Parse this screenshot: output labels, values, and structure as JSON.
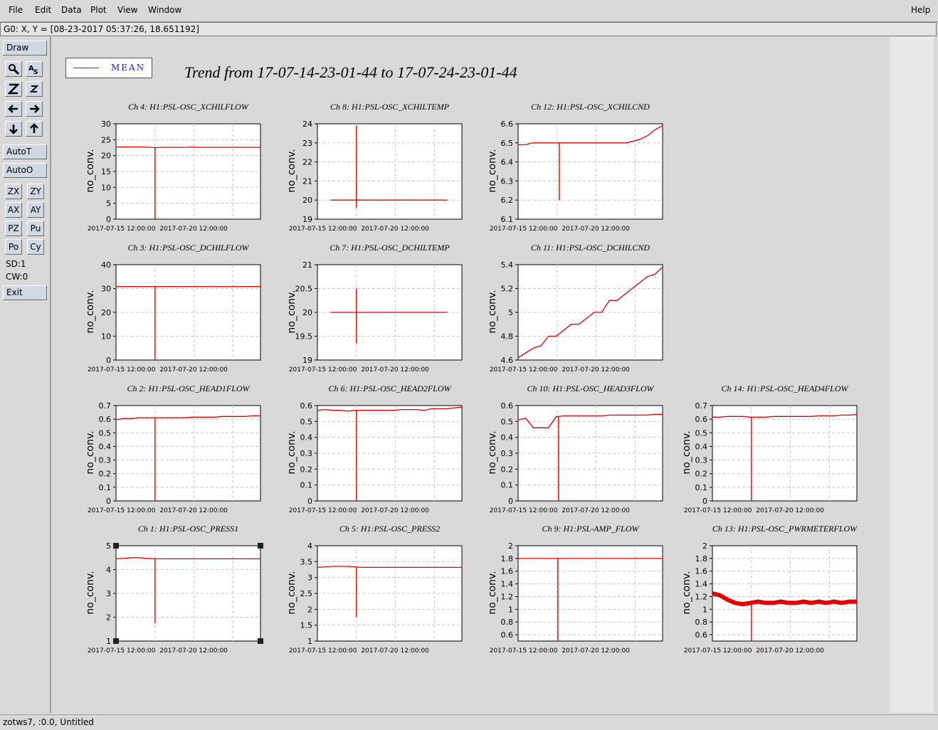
{
  "menubar": {
    "items": [
      {
        "label": "File"
      },
      {
        "label": "Edit"
      },
      {
        "label": "Data"
      },
      {
        "label": "Plot"
      },
      {
        "label": "View"
      },
      {
        "label": "Window"
      }
    ],
    "help": "Help"
  },
  "coord_readout": "G0: X, Y = [08-23-2017 05:37:26, 18.651192]",
  "toolbar": {
    "draw": "Draw",
    "autot": "AutoT",
    "autoo": "AutoO",
    "pairs": [
      [
        "ZX",
        "ZY"
      ],
      [
        "AX",
        "AY"
      ],
      [
        "PZ",
        "Pu"
      ],
      [
        "Po",
        "Cy"
      ]
    ],
    "sd": "SD:1",
    "cw": "CW:0",
    "exit": "Exit"
  },
  "legend": {
    "label": "MEAN",
    "color": "#e00000"
  },
  "title": "Trend from 17-07-14-23-01-44 to 17-07-24-23-01-44",
  "status": "zotws7, :0.0, Untitled",
  "chart_data": [
    {
      "type": "line",
      "title": "Ch 4: H1:PSL-OSC_XCHILFLOW",
      "ylabel": "no_conv.",
      "ylim": [
        0,
        30
      ],
      "yticks": [
        "0",
        "5",
        "10",
        "15",
        "20",
        "25",
        "30"
      ],
      "xticks": [
        "2017-07-15 12:00:00",
        "2017-07-20 12:00:00"
      ],
      "series": [
        {
          "values": [
            22.7,
            22.7,
            22.7,
            22.7,
            22.7,
            22.5,
            22.6,
            22.6,
            22.6,
            22.6,
            22.7,
            22.6,
            22.6,
            22.6,
            22.6,
            22.6,
            22.6,
            22.6,
            22.6,
            22.6
          ],
          "spike_down": 0
        }
      ]
    },
    {
      "type": "line",
      "title": "Ch 8: H1:PSL-OSC_XCHILTEMP",
      "ylabel": "no_conv.",
      "ylim": [
        19,
        24
      ],
      "yticks": [
        "19",
        "20",
        "21",
        "22",
        "23",
        "24"
      ],
      "xticks": [
        "2017-07-15 12:00:00",
        "2017-07-20 12:00:00"
      ],
      "series": [
        {
          "values": [
            20,
            20,
            20,
            20,
            20,
            20,
            20,
            20,
            20,
            20,
            20,
            20,
            20,
            20,
            20,
            20,
            20,
            20
          ],
          "spike_up": 23.9,
          "spike_down": 19.6
        }
      ]
    },
    {
      "type": "line",
      "title": "Ch 12: H1:PSL-OSC_XCHILCND",
      "ylabel": "no_conv.",
      "ylim": [
        6.1,
        6.6
      ],
      "yticks": [
        "6.1",
        "6.2",
        "6.3",
        "6.4",
        "6.5",
        "6.6"
      ],
      "xticks": [
        "2017-07-15 12:00:00",
        "2017-07-20 12:00:00"
      ],
      "series": [
        {
          "values": [
            6.49,
            6.49,
            6.5,
            6.5,
            6.5,
            6.5,
            6.5,
            6.5,
            6.5,
            6.5,
            6.5,
            6.5,
            6.5,
            6.5,
            6.5,
            6.5,
            6.51,
            6.52,
            6.54,
            6.57,
            6.59
          ],
          "spike_down": 6.2
        }
      ]
    },
    {
      "type": "line",
      "title": "Ch 3: H1:PSL-OSC_DCHILFLOW",
      "ylabel": "no_conv.",
      "ylim": [
        0,
        40
      ],
      "yticks": [
        "0",
        "10",
        "20",
        "30",
        "40"
      ],
      "xticks": [
        "2017-07-15 12:00:00",
        "2017-07-20 12:00:00"
      ],
      "series": [
        {
          "values": [
            30.8,
            30.8,
            30.8,
            30.8,
            30.8,
            30.8,
            30.8,
            30.8,
            30.8,
            30.8,
            30.8,
            30.8,
            30.8,
            30.8,
            30.8,
            30.8,
            30.8,
            30.8,
            30.8,
            30.8
          ],
          "spike_down": 0
        }
      ]
    },
    {
      "type": "line",
      "title": "Ch 7: H1:PSL-OSC_DCHILTEMP",
      "ylabel": "no_conv.",
      "ylim": [
        19,
        21
      ],
      "yticks": [
        "19",
        "19.5",
        "20",
        "20.5",
        "21"
      ],
      "xticks": [
        "2017-07-15 12:00:00",
        "2017-07-20 12:00:00"
      ],
      "series": [
        {
          "values": [
            20,
            20,
            20,
            20,
            20,
            20,
            20,
            20,
            20,
            20,
            20,
            20,
            20,
            20,
            20,
            20,
            20,
            20
          ],
          "spike_up": 20.5,
          "spike_down": 19.35
        }
      ]
    },
    {
      "type": "line",
      "title": "Ch 11: H1:PSL-OSC_DCHILCND",
      "ylabel": "no_conv.",
      "ylim": [
        4.6,
        5.4
      ],
      "yticks": [
        "4.6",
        "4.8",
        "5",
        "5.2",
        "5.4"
      ],
      "xticks": [
        "2017-07-15 12:00:00",
        "2017-07-20 12:00:00"
      ],
      "series": [
        {
          "values": [
            4.62,
            4.66,
            4.7,
            4.72,
            4.8,
            4.8,
            4.85,
            4.9,
            4.9,
            4.95,
            5.0,
            5.0,
            5.1,
            5.1,
            5.15,
            5.2,
            5.25,
            5.3,
            5.32,
            5.38
          ]
        }
      ]
    },
    {
      "type": "line",
      "title": "Ch 2: H1:PSL-OSC_HEAD1FLOW",
      "ylabel": "no_conv.",
      "ylim": [
        0,
        0.7
      ],
      "yticks": [
        "0",
        "0.1",
        "0.2",
        "0.3",
        "0.4",
        "0.5",
        "0.6",
        "0.7"
      ],
      "xticks": [
        "2017-07-15 12:00:00",
        "2017-07-20 12:00:00"
      ],
      "series": [
        {
          "values": [
            0.595,
            0.605,
            0.605,
            0.61,
            0.61,
            0.61,
            0.61,
            0.61,
            0.61,
            0.61,
            0.615,
            0.615,
            0.615,
            0.615,
            0.62,
            0.62,
            0.62,
            0.62,
            0.625,
            0.625
          ],
          "spike_down": 0
        }
      ]
    },
    {
      "type": "line",
      "title": "Ch 6: H1:PSL-OSC_HEAD2FLOW",
      "ylabel": "no_conv.",
      "ylim": [
        0,
        0.6
      ],
      "yticks": [
        "0",
        "0.1",
        "0.2",
        "0.3",
        "0.4",
        "0.5",
        "0.6"
      ],
      "xticks": [
        "2017-07-15 12:00:00",
        "2017-07-20 12:00:00"
      ],
      "series": [
        {
          "values": [
            0.57,
            0.575,
            0.57,
            0.57,
            0.565,
            0.57,
            0.57,
            0.57,
            0.57,
            0.57,
            0.57,
            0.575,
            0.575,
            0.575,
            0.57,
            0.58,
            0.58,
            0.58,
            0.585,
            0.59
          ],
          "spike_down": 0
        }
      ]
    },
    {
      "type": "line",
      "title": "Ch 10: H1:PSL-OSC_HEAD3FLOW",
      "ylabel": "no_conv.",
      "ylim": [
        0,
        0.6
      ],
      "yticks": [
        "0",
        "0.1",
        "0.2",
        "0.3",
        "0.4",
        "0.5",
        "0.6"
      ],
      "xticks": [
        "2017-07-15 12:00:00",
        "2017-07-20 12:00:00"
      ],
      "series": [
        {
          "values": [
            0.51,
            0.52,
            0.46,
            0.46,
            0.46,
            0.53,
            0.535,
            0.535,
            0.535,
            0.535,
            0.535,
            0.535,
            0.54,
            0.54,
            0.54,
            0.54,
            0.54,
            0.54,
            0.545,
            0.545
          ],
          "spike_down": 0
        }
      ]
    },
    {
      "type": "line",
      "title": "Ch 14: H1:PSL-OSC_HEAD4FLOW",
      "ylabel": "no_conv.",
      "ylim": [
        0,
        0.7
      ],
      "yticks": [
        "0",
        "0.1",
        "0.2",
        "0.3",
        "0.4",
        "0.5",
        "0.6",
        "0.7"
      ],
      "xticks": [
        "2017-07-15 12:00:00",
        "2017-07-20 12:00:00"
      ],
      "series": [
        {
          "values": [
            0.615,
            0.615,
            0.62,
            0.62,
            0.62,
            0.615,
            0.615,
            0.615,
            0.62,
            0.62,
            0.62,
            0.62,
            0.62,
            0.62,
            0.625,
            0.625,
            0.625,
            0.63,
            0.63,
            0.635
          ],
          "spike_down": 0
        }
      ]
    },
    {
      "type": "line",
      "title": "Ch 1: H1:PSL-OSC_PRESS1",
      "ylabel": "no_conv.",
      "ylim": [
        1,
        5
      ],
      "yticks": [
        "1",
        "2",
        "3",
        "4",
        "5"
      ],
      "xticks": [
        "2017-07-15 12:00:00",
        "2017-07-20 12:00:00"
      ],
      "series": [
        {
          "values": [
            4.45,
            4.47,
            4.5,
            4.5,
            4.47,
            4.45,
            4.45,
            4.45,
            4.45,
            4.45,
            4.45,
            4.45,
            4.45,
            4.45,
            4.45,
            4.45,
            4.45,
            4.45,
            4.45,
            4.45
          ],
          "spike_down": 1.75
        }
      ]
    },
    {
      "type": "line",
      "title": "Ch 5: H1:PSL-OSC_PRESS2",
      "ylabel": "no_conv.",
      "ylim": [
        1,
        4
      ],
      "yticks": [
        "1",
        "1.5",
        "2",
        "2.5",
        "3",
        "3.5",
        "4"
      ],
      "xticks": [
        "2017-07-15 12:00:00",
        "2017-07-20 12:00:00"
      ],
      "series": [
        {
          "values": [
            3.32,
            3.33,
            3.35,
            3.35,
            3.35,
            3.33,
            3.32,
            3.32,
            3.32,
            3.32,
            3.32,
            3.32,
            3.32,
            3.32,
            3.32,
            3.32,
            3.32,
            3.32,
            3.32,
            3.32
          ],
          "spike_down": 1.75
        }
      ]
    },
    {
      "type": "line",
      "title": "Ch 9: H1:PSL-AMP_FLOW",
      "ylabel": "no_conv.",
      "ylim": [
        0.5,
        2
      ],
      "yticks": [
        "0.6",
        "0.8",
        "1",
        "1.2",
        "1.4",
        "1.6",
        "1.8",
        "2"
      ],
      "xticks": [
        "2017-07-15 12:00:00",
        "2017-07-20 12:00:00"
      ],
      "series": [
        {
          "values": [
            1.8,
            1.8,
            1.8,
            1.8,
            1.8,
            1.8,
            1.8,
            1.8,
            1.8,
            1.8,
            1.8,
            1.8,
            1.8,
            1.8,
            1.8,
            1.8,
            1.8,
            1.8,
            1.8,
            1.8
          ],
          "spike_down": 0.5
        }
      ]
    },
    {
      "type": "line",
      "title": "Ch 13: H1:PSL-OSC_PWRMETERFLOW",
      "ylabel": "no_conv.",
      "ylim": [
        0.5,
        2
      ],
      "yticks": [
        "0.6",
        "0.8",
        "1",
        "1.2",
        "1.4",
        "1.6",
        "1.8",
        "2"
      ],
      "xticks": [
        "2017-07-15 12:00:00",
        "2017-07-20 12:00:00"
      ],
      "series": [
        {
          "values": [
            1.25,
            1.22,
            1.15,
            1.1,
            1.08,
            1.1,
            1.12,
            1.1,
            1.1,
            1.12,
            1.1,
            1.1,
            1.12,
            1.1,
            1.12,
            1.1,
            1.12,
            1.1,
            1.12,
            1.12
          ],
          "spike_down": 0.5,
          "noise": 0.1
        }
      ]
    }
  ]
}
